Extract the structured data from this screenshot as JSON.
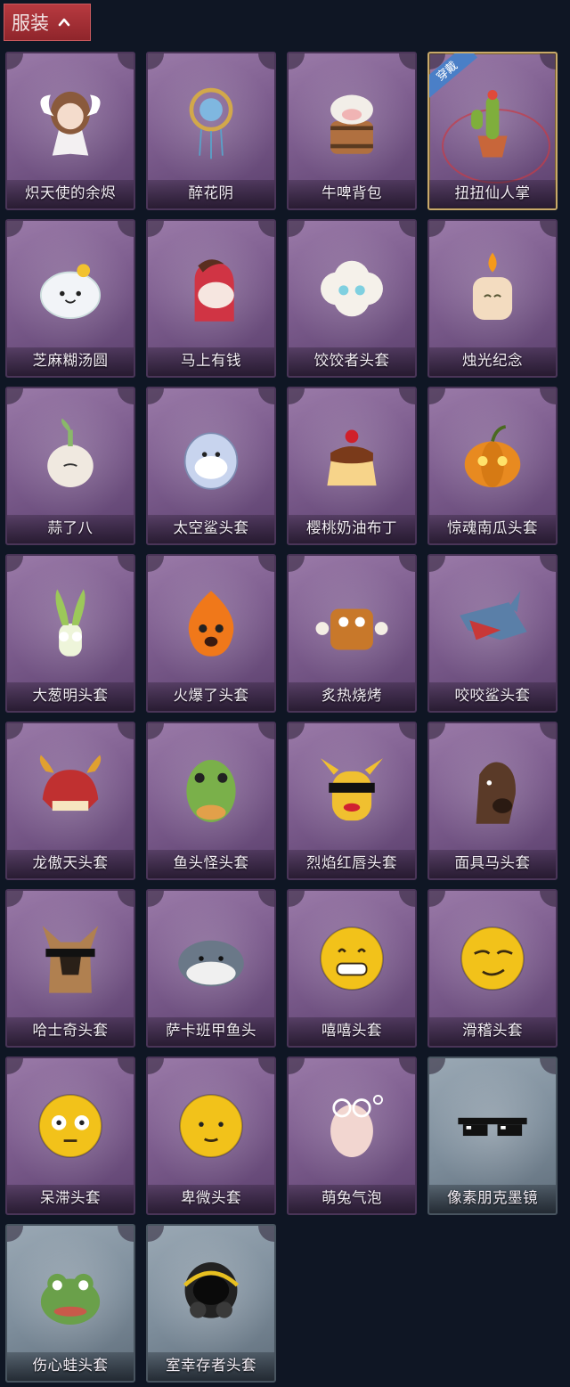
{
  "header": {
    "label": "服装"
  },
  "badge_text": "穿戴",
  "items": [
    {
      "name": "炽天使的余烬",
      "style": "purple",
      "icon": "angel-figure",
      "color": "#e8d2c0"
    },
    {
      "name": "醉花阴",
      "style": "purple",
      "icon": "dreamcatcher",
      "color": "#7fb7e0"
    },
    {
      "name": "牛啤背包",
      "style": "purple",
      "icon": "cow-barrel",
      "color": "#b07040"
    },
    {
      "name": "扭扭仙人掌",
      "style": "purple",
      "icon": "cactus-pot",
      "color": "#7fae3c",
      "equipped": true
    },
    {
      "name": "芝麻糊汤圆",
      "style": "purple",
      "icon": "dumpling",
      "color": "#f2f4f8"
    },
    {
      "name": "马上有钱",
      "style": "purple",
      "icon": "horse-head",
      "color": "#d03444"
    },
    {
      "name": "饺饺者头套",
      "style": "purple",
      "icon": "cloud-dumpling",
      "color": "#f5f1ea"
    },
    {
      "name": "烛光纪念",
      "style": "purple",
      "icon": "candle",
      "color": "#f3dcc0"
    },
    {
      "name": "蒜了八",
      "style": "purple",
      "icon": "garlic",
      "color": "#f0e9e0"
    },
    {
      "name": "太空鲨头套",
      "style": "purple",
      "icon": "shark-helmet",
      "color": "#c8d4ee"
    },
    {
      "name": "樱桃奶油布丁",
      "style": "purple",
      "icon": "pudding",
      "color": "#f0b060"
    },
    {
      "name": "惊魂南瓜头套",
      "style": "purple",
      "icon": "pumpkin",
      "color": "#e88a20"
    },
    {
      "name": "大葱明头套",
      "style": "purple",
      "icon": "scallion",
      "color": "#9cc85a"
    },
    {
      "name": "火爆了头套",
      "style": "purple",
      "icon": "fire-head",
      "color": "#f0781a"
    },
    {
      "name": "炙热烧烤",
      "style": "purple",
      "icon": "bbq-meat",
      "color": "#c8782a"
    },
    {
      "name": "咬咬鲨头套",
      "style": "purple",
      "icon": "shark",
      "color": "#5a7fa8"
    },
    {
      "name": "龙傲天头套",
      "style": "purple",
      "icon": "dragon-head",
      "color": "#c03030"
    },
    {
      "name": "鱼头怪头套",
      "style": "purple",
      "icon": "fish-head",
      "color": "#7ab04a"
    },
    {
      "name": "烈焰红唇头套",
      "style": "purple",
      "icon": "pikachu-shades",
      "color": "#f0c030"
    },
    {
      "name": "面具马头套",
      "style": "purple",
      "icon": "horse-mask",
      "color": "#5a3a28"
    },
    {
      "name": "哈士奇头套",
      "style": "purple",
      "icon": "husky",
      "color": "#b08050"
    },
    {
      "name": "萨卡班甲鱼头",
      "style": "purple",
      "icon": "fish-sacabambaspis",
      "color": "#6a7888"
    },
    {
      "name": "嘻嘻头套",
      "style": "purple",
      "icon": "grin-emoji",
      "color": "#f2c21a"
    },
    {
      "name": "滑稽头套",
      "style": "purple",
      "icon": "funny-emoji",
      "color": "#f2c21a"
    },
    {
      "name": "呆滞头套",
      "style": "purple",
      "icon": "stare-emoji",
      "color": "#f2c21a"
    },
    {
      "name": "卑微头套",
      "style": "purple",
      "icon": "humble-emoji",
      "color": "#f2c21a"
    },
    {
      "name": "萌兔气泡",
      "style": "purple",
      "icon": "bunny-bubble",
      "color": "#f2d6d0"
    },
    {
      "name": "像素朋克墨镜",
      "style": "grey",
      "icon": "pixel-sunglasses",
      "color": "#111111"
    },
    {
      "name": "伤心蛙头套",
      "style": "grey",
      "icon": "sad-frog",
      "color": "#6aa04a"
    },
    {
      "name": "室幸存者头套",
      "style": "grey",
      "icon": "gas-mask",
      "color": "#222222"
    }
  ]
}
